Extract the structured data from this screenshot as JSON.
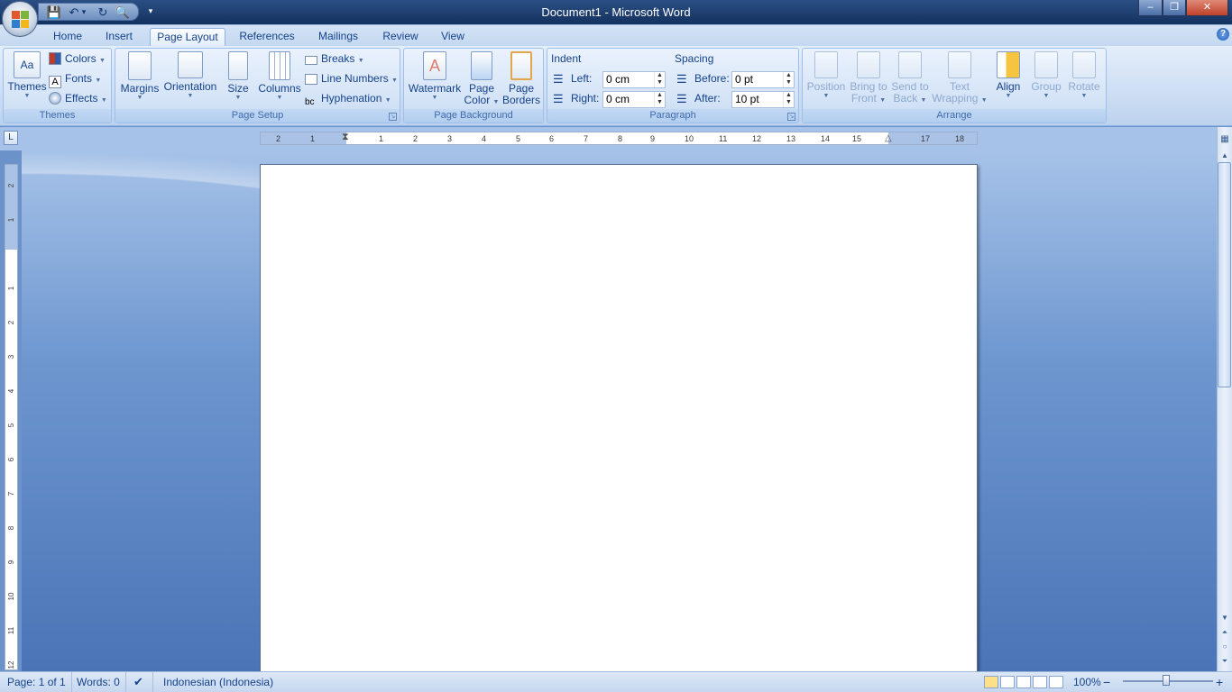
{
  "window": {
    "title": "Document1 - Microsoft Word",
    "minimize": "–",
    "restore": "❐",
    "close": "✕"
  },
  "qat": {
    "save": "💾",
    "undo": "↶",
    "undo_drop": "▾",
    "redo": "↻",
    "preview": "🔍",
    "customize": "▾"
  },
  "tabs": [
    {
      "label": "Home"
    },
    {
      "label": "Insert"
    },
    {
      "label": "Page Layout"
    },
    {
      "label": "References"
    },
    {
      "label": "Mailings"
    },
    {
      "label": "Review"
    },
    {
      "label": "View"
    }
  ],
  "help": "?",
  "themes": {
    "group_label": "Themes",
    "themes_label": "Themes",
    "colors_label": "Colors",
    "fonts_label": "Fonts",
    "effects_label": "Effects"
  },
  "page_setup": {
    "group_label": "Page Setup",
    "margins": "Margins",
    "orientation": "Orientation",
    "size": "Size",
    "columns": "Columns",
    "breaks": "Breaks",
    "line_numbers": "Line Numbers",
    "hyphenation": "Hyphenation"
  },
  "page_background": {
    "group_label": "Page Background",
    "watermark": "Watermark",
    "page_color_1": "Page",
    "page_color_2": "Color",
    "page_borders_1": "Page",
    "page_borders_2": "Borders"
  },
  "paragraph": {
    "group_label": "Paragraph",
    "indent_title": "Indent",
    "left_label": "Left:",
    "left_value": "0 cm",
    "right_label": "Right:",
    "right_value": "0 cm",
    "spacing_title": "Spacing",
    "before_label": "Before:",
    "before_value": "0 pt",
    "after_label": "After:",
    "after_value": "10 pt"
  },
  "arrange": {
    "group_label": "Arrange",
    "position": "Position",
    "bring_1": "Bring to",
    "bring_2": "Front",
    "send_1": "Send to",
    "send_2": "Back",
    "wrap_1": "Text",
    "wrap_2": "Wrapping",
    "align": "Align",
    "group": "Group",
    "rotate": "Rotate"
  },
  "ruler": {
    "ticks": [
      "2",
      "1",
      "1",
      "2",
      "3",
      "4",
      "5",
      "6",
      "7",
      "8",
      "9",
      "10",
      "11",
      "12",
      "13",
      "14",
      "15",
      "17",
      "18"
    ],
    "vticks": [
      "2",
      "1",
      "1",
      "2",
      "3",
      "4",
      "5",
      "6",
      "7",
      "8",
      "9",
      "10",
      "11",
      "12"
    ],
    "tab_selector": "L"
  },
  "status": {
    "page": "Page: 1 of 1",
    "words": "Words: 0",
    "language": "Indonesian (Indonesia)",
    "zoom": "100%",
    "zoom_minus": "−",
    "zoom_plus": "+"
  }
}
